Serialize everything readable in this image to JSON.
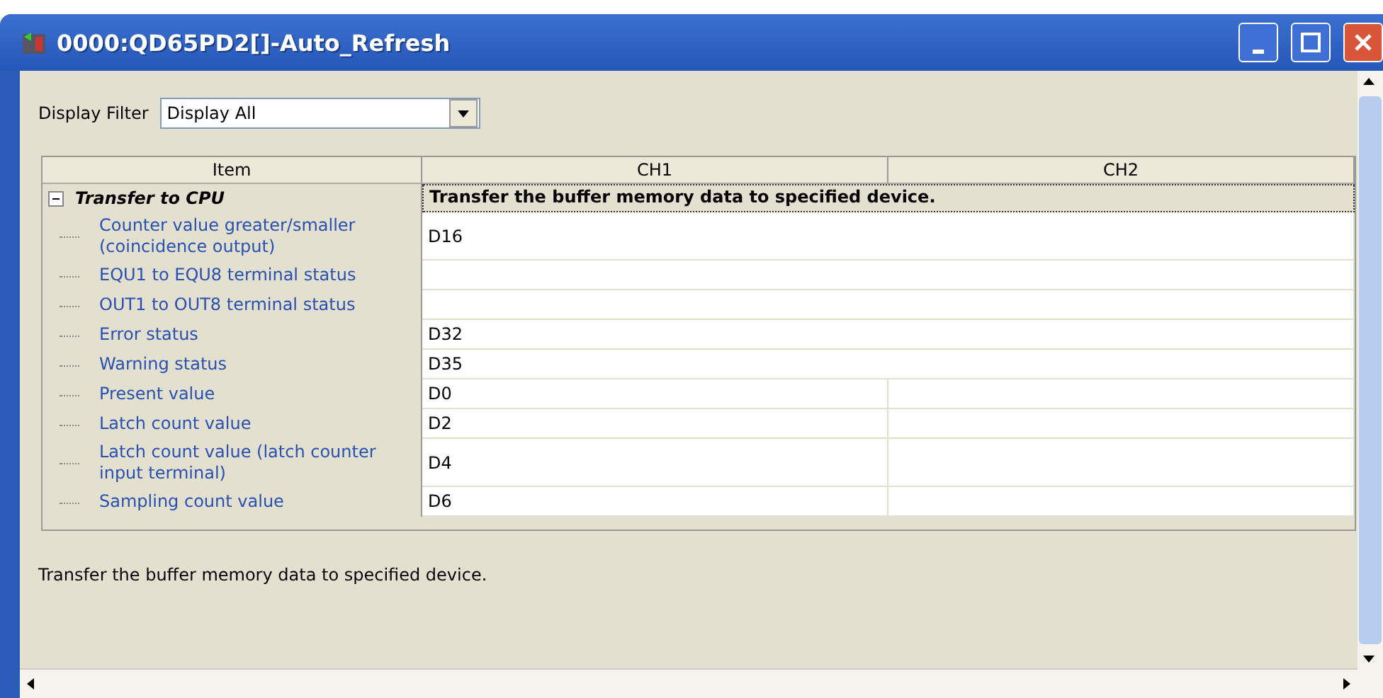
{
  "window": {
    "title": "0000:QD65PD2[]-Auto_Refresh"
  },
  "filter": {
    "label": "Display Filter",
    "value": "Display All"
  },
  "table": {
    "columns": [
      "Item",
      "CH1",
      "CH2"
    ],
    "group": {
      "label": "Transfer to CPU",
      "expanded": true,
      "value": "Transfer the buffer memory data to specified device."
    },
    "rows": [
      {
        "item": "Counter value greater/smaller (coincidence output)",
        "kind": "merged",
        "ch1": "D16"
      },
      {
        "item": "EQU1 to EQU8 terminal status",
        "kind": "merged",
        "ch1": ""
      },
      {
        "item": "OUT1 to OUT8 terminal status",
        "kind": "merged",
        "ch1": ""
      },
      {
        "item": "Error status",
        "kind": "merged",
        "ch1": "D32"
      },
      {
        "item": "Warning status",
        "kind": "merged",
        "ch1": "D35"
      },
      {
        "item": "Present value",
        "kind": "split",
        "ch1": "D0"
      },
      {
        "item": "Latch count value",
        "kind": "split",
        "ch1": "D2"
      },
      {
        "item": "Latch count value (latch counter input terminal)",
        "kind": "split",
        "ch1": "D4"
      },
      {
        "item": "Sampling count value",
        "kind": "split",
        "ch1": "D6"
      }
    ]
  },
  "description": "Transfer the buffer memory data to specified device."
}
